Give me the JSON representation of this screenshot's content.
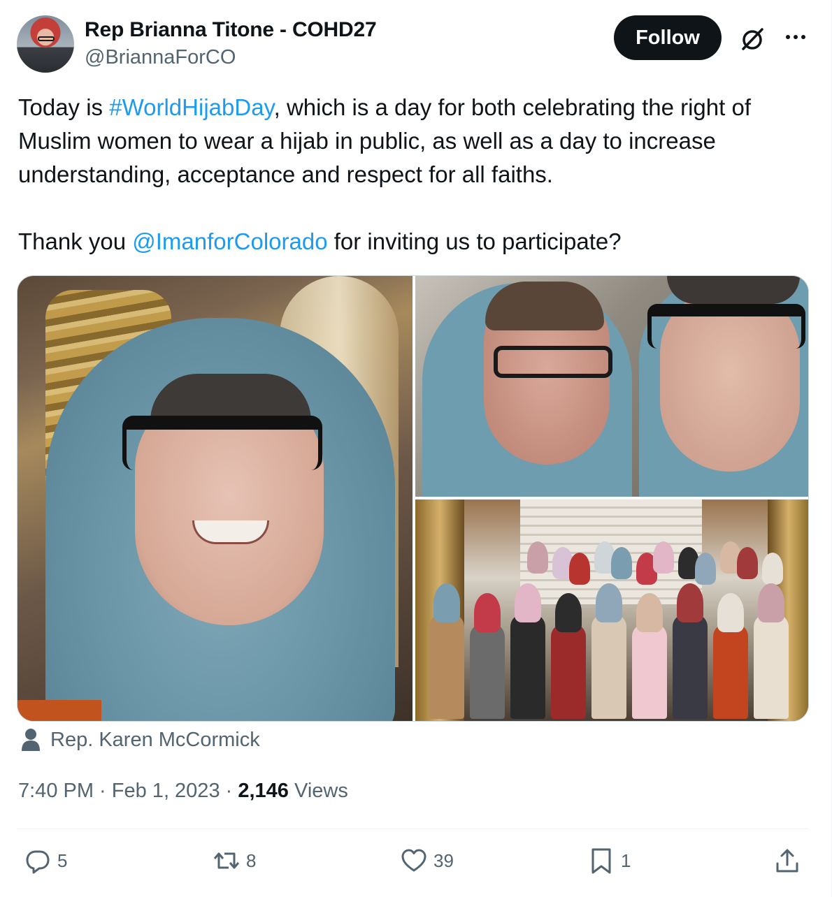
{
  "author": {
    "name": "Rep Brianna Titone - COHD27",
    "handle": "@BriannaForCO"
  },
  "header": {
    "follow_label": "Follow"
  },
  "tweet": {
    "text_part1": "Today is ",
    "hashtag": "#WorldHijabDay",
    "text_part2": ", which is a day for both celebrating the right of Muslim women to wear a hijab in public, as well as a day to increase understanding, acceptance and respect for all faiths.",
    "text_part3": "Thank you ",
    "mention": "@ImanforColorado",
    "text_part4": " for inviting us to participate?"
  },
  "media": {
    "tagged_person": "Rep. Karen McCormick"
  },
  "meta": {
    "time": "7:40 PM",
    "separator": " · ",
    "date": "Feb 1, 2023",
    "views_count": "2,146",
    "views_label": " Views"
  },
  "actions": {
    "replies": "5",
    "retweets": "8",
    "likes": "39",
    "bookmarks": "1"
  },
  "colors": {
    "link": "#1d9bf0",
    "secondary_text": "#536471",
    "primary_text": "#0f1419",
    "follow_button": "#0f1419"
  },
  "icons": [
    "grok-icon",
    "more-icon",
    "person-icon",
    "reply-icon",
    "retweet-icon",
    "like-icon",
    "bookmark-icon",
    "share-icon"
  ]
}
